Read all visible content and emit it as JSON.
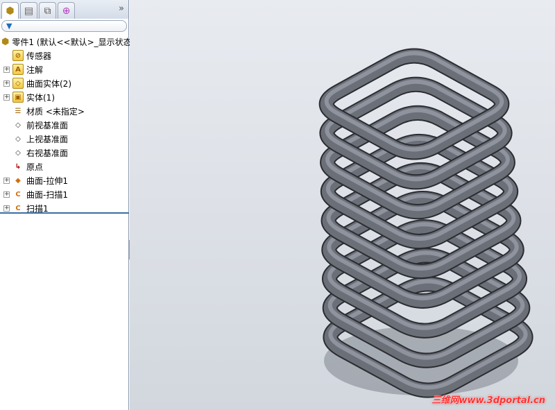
{
  "tabs": [
    {
      "name": "featuremanager-tab",
      "icon": "part-icon"
    },
    {
      "name": "propertymanager-tab",
      "icon": "property-icon"
    },
    {
      "name": "configurationmanager-tab",
      "icon": "config-icon"
    },
    {
      "name": "dimxpert-tab",
      "icon": "target-icon"
    }
  ],
  "more": "»",
  "filter_icon": "filter-icon",
  "tree": {
    "root": "零件1  (默认<<默认>_显示状态",
    "items": [
      {
        "label": "传感器",
        "icon": "sensor-folder-icon",
        "expand": false,
        "glyph": "⊘"
      },
      {
        "label": "注解",
        "icon": "annotation-folder-icon",
        "expand": true,
        "glyph": "A"
      },
      {
        "label": "曲面实体(2)",
        "icon": "surface-body-folder-icon",
        "expand": true,
        "glyph": "◇"
      },
      {
        "label": "实体(1)",
        "icon": "solid-body-folder-icon",
        "expand": true,
        "glyph": "▣"
      },
      {
        "label": "材质 <未指定>",
        "icon": "material-icon",
        "expand": false,
        "glyph": "☰"
      },
      {
        "label": "前视基准面",
        "icon": "plane-icon",
        "expand": false,
        "glyph": "◇"
      },
      {
        "label": "上视基准面",
        "icon": "plane-icon",
        "expand": false,
        "glyph": "◇"
      },
      {
        "label": "右视基准面",
        "icon": "plane-icon",
        "expand": false,
        "glyph": "◇"
      },
      {
        "label": "原点",
        "icon": "origin-icon",
        "expand": false,
        "glyph": "↳"
      },
      {
        "label": "曲面-拉伸1",
        "icon": "surface-extrude-icon",
        "expand": true,
        "glyph": "◆"
      },
      {
        "label": "曲面-扫描1",
        "icon": "surface-sweep-icon",
        "expand": true,
        "glyph": "C"
      },
      {
        "label": "扫描1",
        "icon": "sweep-icon",
        "expand": true,
        "glyph": "C"
      }
    ]
  },
  "watermark": "三维网www.3dportal.cn",
  "colors": {
    "tube": "#6b6f78",
    "tube_highlight": "#9ea3ad",
    "accent": "#3a6ea5"
  }
}
